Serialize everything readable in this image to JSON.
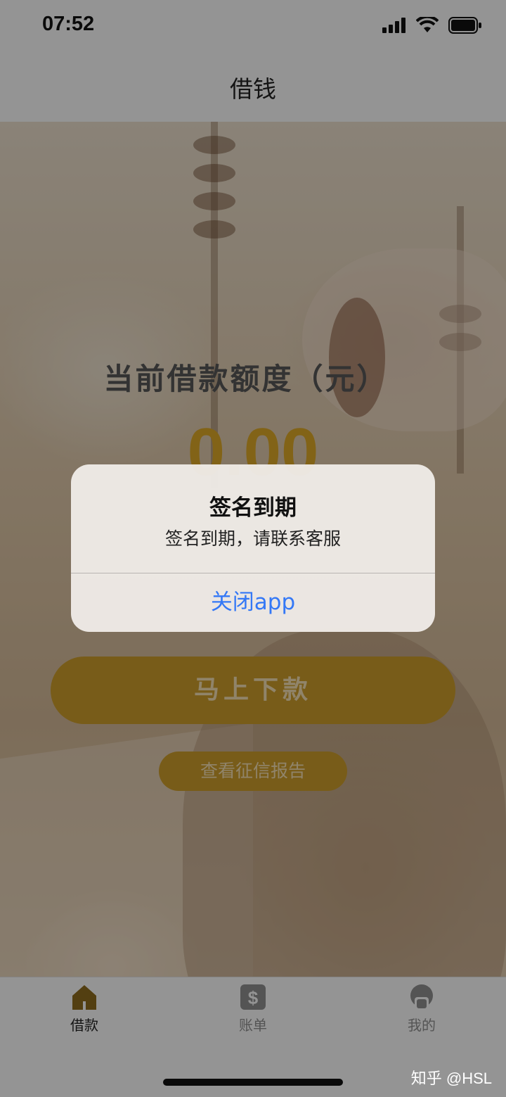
{
  "status_bar": {
    "time": "07:52"
  },
  "nav": {
    "title": "借钱"
  },
  "loan": {
    "limit_label": "当前借款额度（元）",
    "limit_amount": "0.00",
    "withdraw_label": "马上下款",
    "credit_report_label": "查看征信报告"
  },
  "tabs": [
    {
      "label": "借款",
      "icon": "home-icon",
      "active": true
    },
    {
      "label": "账单",
      "icon": "dollar-icon",
      "active": false
    },
    {
      "label": "我的",
      "icon": "profile-icon",
      "active": false
    }
  ],
  "alert": {
    "title": "签名到期",
    "message": "签名到期，请联系客服",
    "button_label": "关闭app"
  },
  "watermark": "知乎 @HSL",
  "colors": {
    "accent_gold": "#c99a2b",
    "amount_gold": "#d9a527",
    "ios_blue": "#3478f6",
    "tab_active": "#8a6a1d",
    "tab_inactive": "#8c8c8c"
  }
}
